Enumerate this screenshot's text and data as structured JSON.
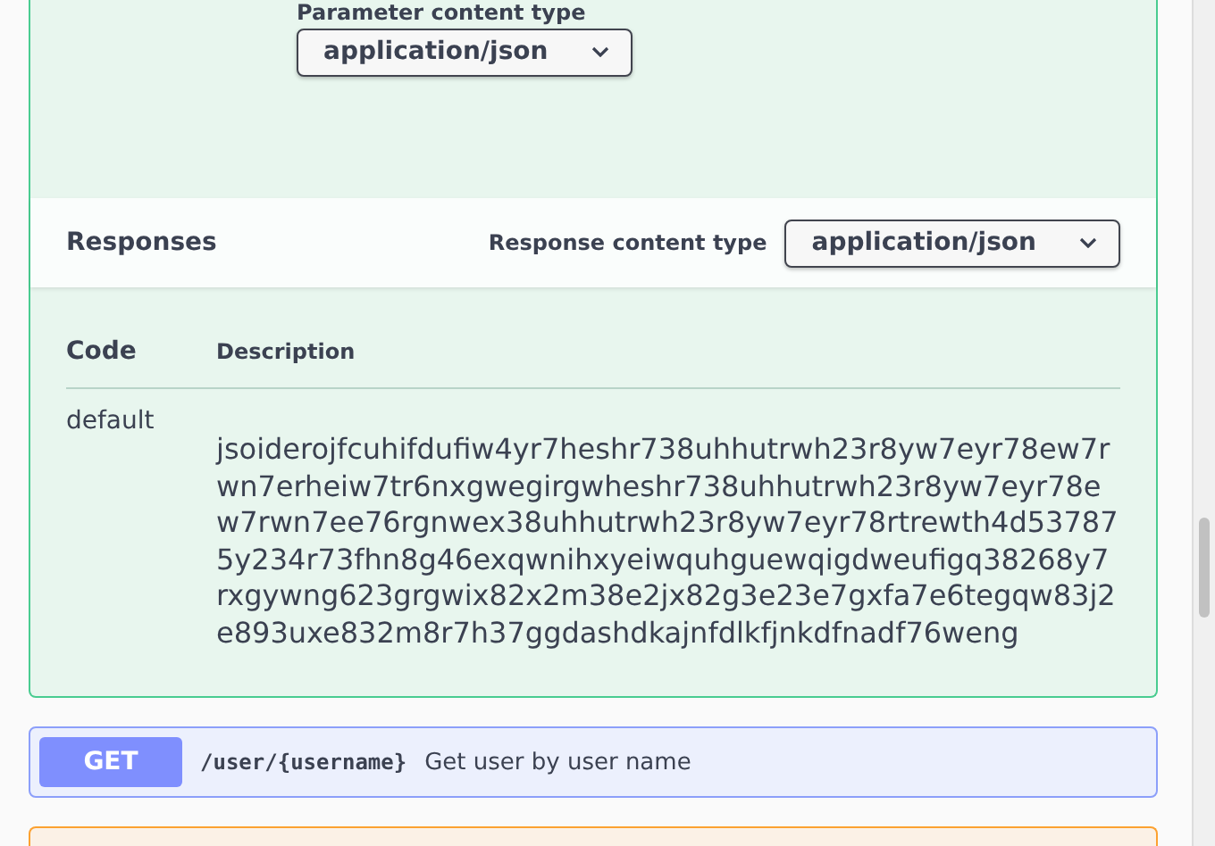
{
  "parameter_content_type": {
    "label": "Parameter content type",
    "value": "application/json"
  },
  "responses": {
    "title": "Responses",
    "content_type_label": "Response content type",
    "content_type_value": "application/json",
    "columns": [
      "Code",
      "Description"
    ],
    "rows": [
      {
        "code": "default",
        "description": "jsoiderojfcuhifdufiw4yr7heshr738uhhutrwh23r8yw7eyr78ew7rwn7erheiw7tr6nxgwegirgwheshr738uhhutrwh23r8yw7eyr78ew7rwn7ee76rgnwex38uhhutrwh23r8yw7eyr78rtrewth4d537875y234r73fhn8g46exqwnihxyeiwquhguewqigdweufigq38268y7rxgywng623grgwix82x2m38e2jx82g3e23e7gxfa7e6tegqw83j2e893uxe832m8r7h37ggdashdkajnfdlkfjnkdfnadf76weng"
      }
    ]
  },
  "operations": [
    {
      "method": "GET",
      "path": "/user/{username}",
      "summary": "Get user by user name"
    }
  ]
}
